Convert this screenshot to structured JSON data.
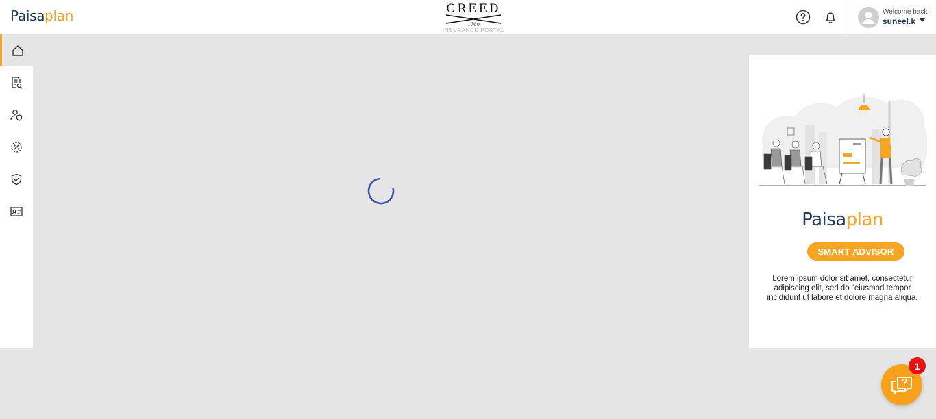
{
  "header": {
    "logo_dark": "Paisa",
    "logo_accent": "plan",
    "brand_name": "CREED",
    "brand_year": "1760",
    "brand_sub": "INSURANCE PORTAL"
  },
  "user": {
    "welcome": "Welcome back",
    "name": "suneel.k"
  },
  "sidebar": {
    "items": [
      {
        "icon": "home-icon",
        "active": true
      },
      {
        "icon": "document-search-icon"
      },
      {
        "icon": "user-shield-icon"
      },
      {
        "icon": "percent-gear-icon"
      },
      {
        "icon": "shield-check-icon"
      },
      {
        "icon": "id-card-icon"
      }
    ]
  },
  "advisor": {
    "logo_dark": "Paisa",
    "logo_accent": "plan",
    "button_label": "SMART ADVISOR",
    "description": "Lorem ipsum dolor sit amet, consectetur adipiscing elit, sed do \"eiusmod tempor incididunt ut labore et dolore magna aliqua."
  },
  "chat": {
    "badge_count": "1"
  },
  "colors": {
    "accent": "#f5a623",
    "brand_dark": "#1f3b5a",
    "spinner": "#3f51b5",
    "badge": "#e81212"
  }
}
